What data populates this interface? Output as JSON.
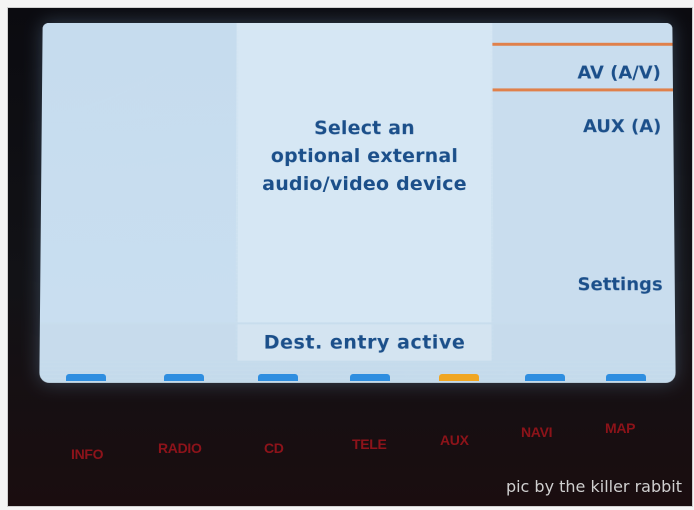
{
  "screen": {
    "center_message_lines": [
      "Select an",
      "optional external",
      "audio/video device"
    ],
    "menu": {
      "av": "AV (A/V)",
      "aux": "AUX (A)",
      "settings": "Settings"
    },
    "status_text": "Dest. entry active"
  },
  "bottom_labels": [
    "INFO",
    "RADIO",
    "CD",
    "TELE",
    "AUX",
    "NAVI",
    "MAP"
  ],
  "softkeys": {
    "count": 7,
    "active_index": 4,
    "colors": {
      "inactive": "#2f8ee0",
      "active": "#f0a623"
    }
  },
  "watermark": "pic by the killer rabbit",
  "colors": {
    "text_blue": "#1b4f8a",
    "selection_line": "#e0804a",
    "button_label_red": "#a2141c"
  }
}
